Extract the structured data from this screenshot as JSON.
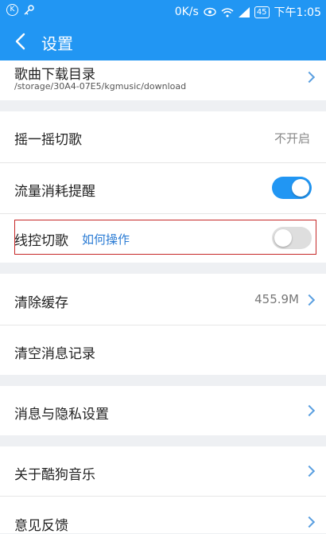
{
  "status_bar": {
    "network_speed": "0K/s",
    "battery": "45",
    "time": "下午1:05"
  },
  "header": {
    "title": "设置"
  },
  "settings": {
    "download_dir": {
      "label": "歌曲下载目录",
      "path": "/storage/30A4-07E5/kgmusic/download"
    },
    "shake": {
      "label": "摇一摇切歌",
      "value": "不开启"
    },
    "data_alert": {
      "label": "流量消耗提醒",
      "enabled": true
    },
    "wire_control": {
      "label": "线控切歌",
      "link": "如何操作",
      "enabled": false
    },
    "clear_cache": {
      "label": "清除缓存",
      "value": "455.9M"
    },
    "clear_messages": {
      "label": "清空消息记录"
    },
    "privacy": {
      "label": "消息与隐私设置"
    },
    "about": {
      "label": "关于酷狗音乐"
    },
    "feedback": {
      "label": "意见反馈"
    }
  }
}
